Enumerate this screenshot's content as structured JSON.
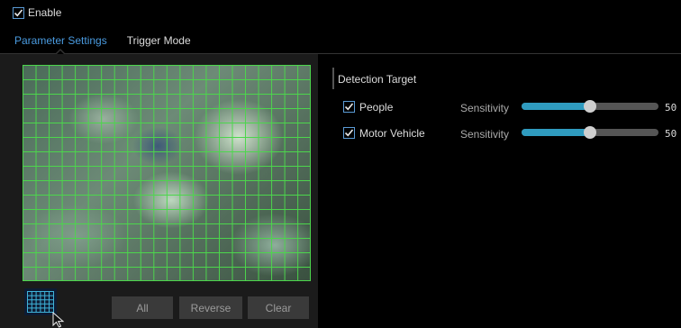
{
  "enable": {
    "label": "Enable",
    "checked": true
  },
  "tabs": [
    {
      "label": "Parameter Settings",
      "active": true
    },
    {
      "label": "Trigger Mode",
      "active": false
    }
  ],
  "video": {
    "grid_color": "#4cd64c"
  },
  "area_buttons": {
    "all": "All",
    "reverse": "Reverse",
    "clear": "Clear"
  },
  "detection": {
    "title": "Detection Target",
    "targets": [
      {
        "label": "People",
        "checked": true,
        "sensitivity_label": "Sensitivity",
        "value": "50",
        "level_percent": 50
      },
      {
        "label": "Motor Vehicle",
        "checked": true,
        "sensitivity_label": "Sensitivity",
        "value": "50",
        "level_percent": 50
      }
    ]
  },
  "colors": {
    "accent": "#4a9be0",
    "slider_fill": "#2f9bbf",
    "check_border": "#5b9bd5"
  }
}
